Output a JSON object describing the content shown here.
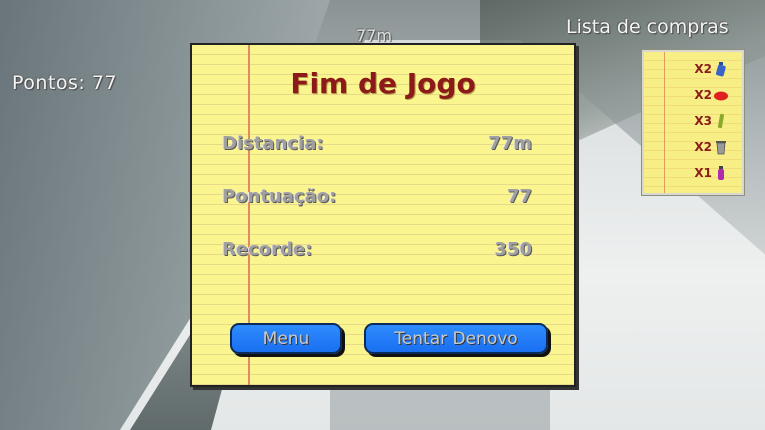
{
  "hud": {
    "score_text": "Pontos: 77",
    "top_distance": "77m",
    "shopping_list_title": "Lista de compras"
  },
  "shopping_list": [
    {
      "qty": "X2",
      "icon": "bottle-icon",
      "color": "#3a63c8"
    },
    {
      "qty": "X2",
      "icon": "sausage-icon",
      "color": "#e02020"
    },
    {
      "qty": "X3",
      "icon": "tube-icon",
      "color": "#8aa82a"
    },
    {
      "qty": "X2",
      "icon": "trash-bin-icon",
      "color": "#9a9a9a"
    },
    {
      "qty": "X1",
      "icon": "spray-can-icon",
      "color": "#b02ab0"
    }
  ],
  "game_over": {
    "title": "Fim de Jogo",
    "stats": [
      {
        "label": "Distancia:",
        "value": "77m"
      },
      {
        "label": "Pontuação:",
        "value": "77"
      },
      {
        "label": "Recorde:",
        "value": "350"
      }
    ],
    "menu_button": "Menu",
    "retry_button": "Tentar Denovo"
  },
  "colors": {
    "title": "#8c1a1a",
    "button": "#1a6ff0",
    "notepad": "#fbf58f"
  }
}
